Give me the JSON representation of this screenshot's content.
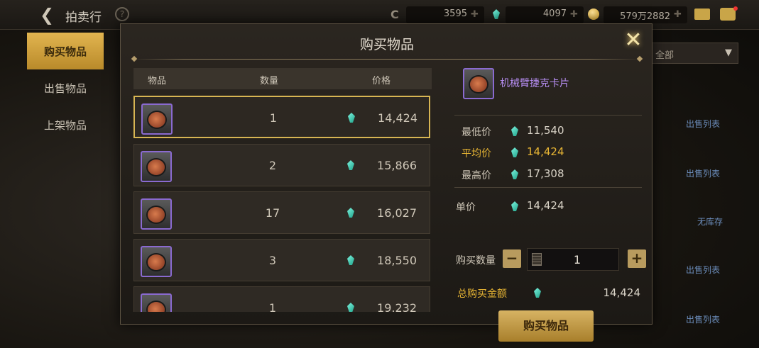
{
  "topbar": {
    "title": "拍卖行",
    "help": "?",
    "res1": "3595",
    "res2": "4097",
    "res3": "579万2882"
  },
  "sidenav": [
    {
      "label": "购买物品"
    },
    {
      "label": "出售物品"
    },
    {
      "label": "上架物品"
    }
  ],
  "bg_right": {
    "filter": "全部",
    "links": [
      "出售列表",
      "出售列表",
      "无库存",
      "出售列表",
      "出售列表"
    ]
  },
  "dialog": {
    "title": "购买物品",
    "columns": {
      "item": "物品",
      "qty": "数量",
      "price": "价格"
    },
    "rows": [
      {
        "qty": "1",
        "price": "14,424"
      },
      {
        "qty": "2",
        "price": "15,866"
      },
      {
        "qty": "17",
        "price": "16,027"
      },
      {
        "qty": "3",
        "price": "18,550"
      },
      {
        "qty": "1",
        "price": "19,232"
      }
    ],
    "item_name": "机械臂捷克卡片",
    "stats": {
      "min_label": "最低价",
      "min": "11,540",
      "avg_label": "平均价",
      "avg": "14,424",
      "max_label": "最高价",
      "max": "17,308"
    },
    "unit_label": "单价",
    "unit_price": "14,424",
    "qty_label": "购买数量",
    "qty_value": "1",
    "total_label": "总购买金额",
    "total": "14,424",
    "buy_button": "购买物品",
    "minus": "−",
    "plus": "+"
  },
  "colors": {
    "accent": "#d7b553",
    "gem": "#3bd3b5",
    "purple": "#b58cf0"
  }
}
